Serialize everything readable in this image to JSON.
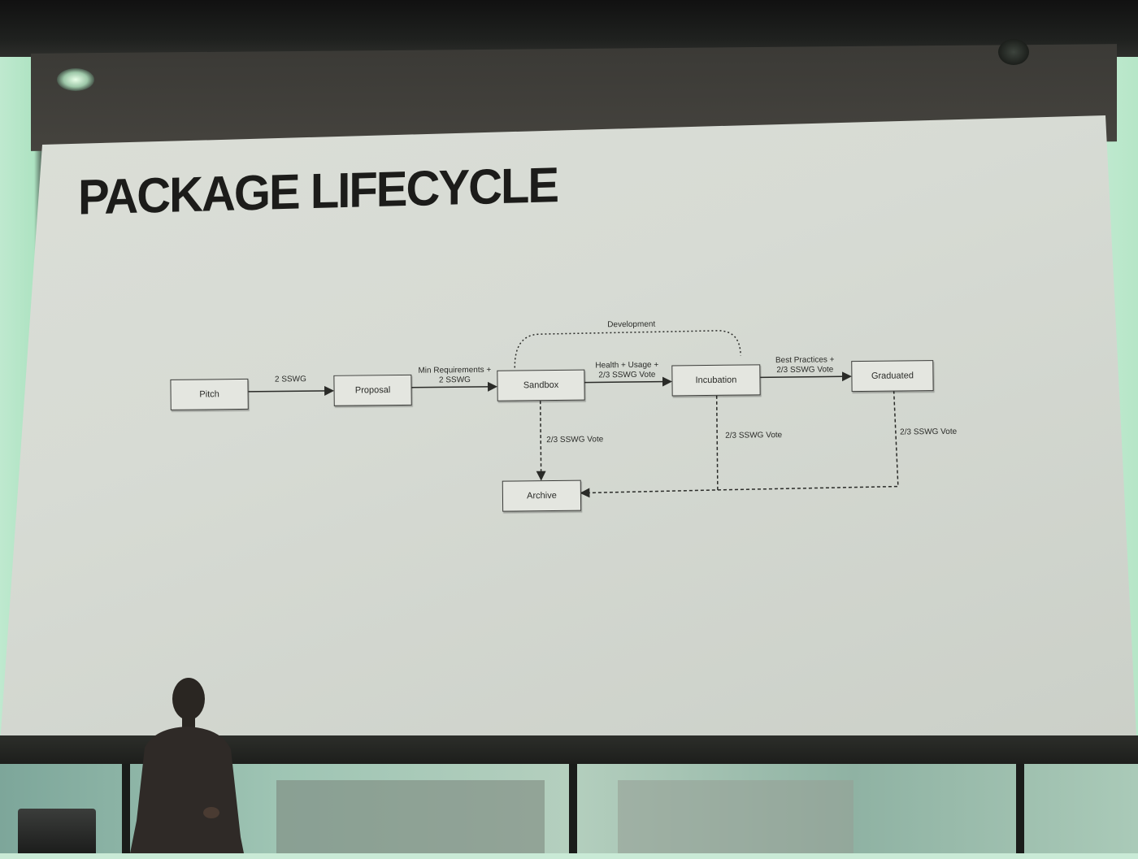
{
  "slide": {
    "title": "PACKAGE LIFECYCLE"
  },
  "diagram": {
    "nodes": {
      "pitch": "Pitch",
      "proposal": "Proposal",
      "sandbox": "Sandbox",
      "incubation": "Incubation",
      "graduated": "Graduated",
      "archive": "Archive"
    },
    "edges": {
      "pitch_to_proposal": "2 SSWG",
      "proposal_to_sandbox_1": "Min Requirements +",
      "proposal_to_sandbox_2": "2 SSWG",
      "sandbox_to_incubation_1": "Health + Usage +",
      "sandbox_to_incubation_2": "2/3 SSWG Vote",
      "incubation_to_graduated_1": "Best Practices +",
      "incubation_to_graduated_2": "2/3 SSWG Vote",
      "sandbox_to_archive": "2/3 SSWG Vote",
      "incubation_to_archive": "2/3 SSWG Vote",
      "graduated_to_archive": "2/3 SSWG Vote",
      "development_bracket": "Development"
    }
  },
  "colors": {
    "screen": "#d9ddd6",
    "ink": "#2a2b28",
    "window_glow": "#b8e8cb"
  }
}
